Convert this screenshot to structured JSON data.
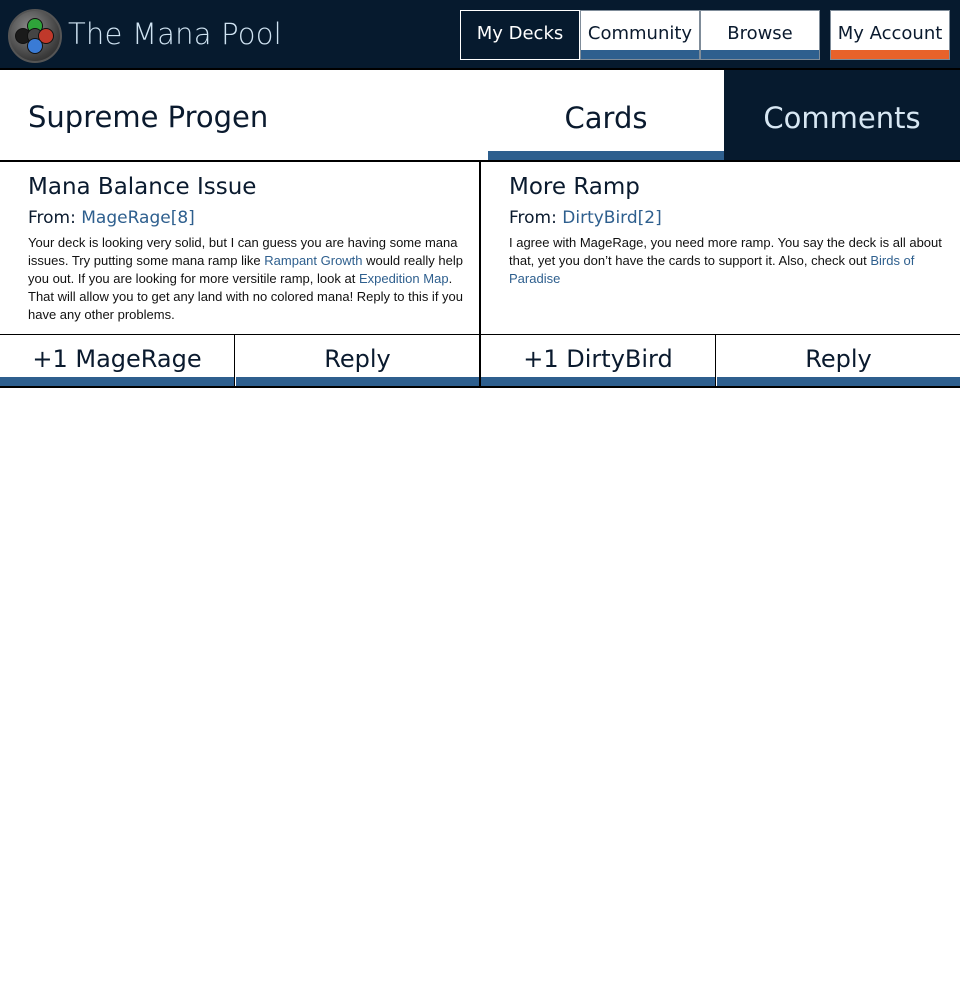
{
  "app": {
    "title": "The Mana Pool",
    "logo_icon": "mana-pool-logo-icon"
  },
  "nav": {
    "my_decks": "My Decks",
    "community": "Community",
    "browse": "Browse",
    "my_account": "My Account"
  },
  "deck": {
    "title": "Supreme Progen",
    "tabs": {
      "cards": "Cards",
      "comments": "Comments"
    }
  },
  "comments": [
    {
      "title": "Mana Balance Issue",
      "from_label": "From:",
      "author": "MageRage[8]",
      "body": {
        "t1": "Your deck is looking very solid, but I can guess you are having some mana issues. Try putting some mana ramp like ",
        "link1": "Rampant Growth",
        "t2": " would really help you out. If you are looking for more versitile ramp, look at ",
        "link2": "Expedition Map",
        "t3": ". That will allow you to get any land with no colored mana! Reply to this if you have any other problems."
      },
      "plus_label": "+1 MageRage",
      "reply_label": "Reply"
    },
    {
      "title": "More Ramp",
      "from_label": "From:",
      "author": "DirtyBird[2]",
      "body": {
        "t1": "I agree with MageRage, you need more ramp. You say the deck is all about that, yet you don’t have the cards to support it. Also, check out ",
        "link1": "Birds of Paradise"
      },
      "plus_label": "+1 DirtyBird",
      "reply_label": "Reply"
    }
  ],
  "colors": {
    "navy": "#061a2e",
    "accent_blue": "#2e5f8e",
    "accent_orange": "#e8622a"
  }
}
